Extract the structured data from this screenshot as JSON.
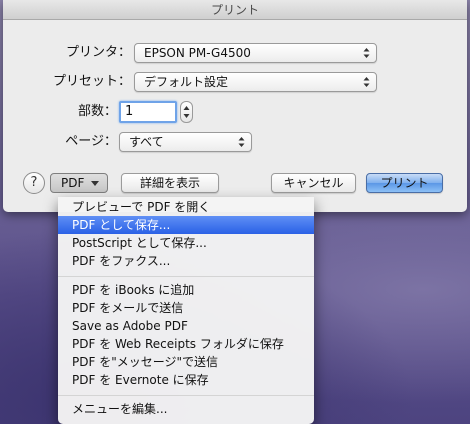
{
  "dialog": {
    "title": "プリント",
    "printer_label": "プリンタ：",
    "printer_value": "EPSON PM-G4500",
    "preset_label": "プリセット：",
    "preset_value": "デフォルト設定",
    "copies_label": "部数：",
    "copies_value": "1",
    "pages_label": "ページ：",
    "pages_value": "すべて",
    "help_label": "?",
    "pdf_label": "PDF",
    "details_label": "詳細を表示",
    "cancel_label": "キャンセル",
    "print_label": "プリント"
  },
  "pdf_menu": {
    "items": [
      "プレビューで PDF を開く",
      "PDF として保存...",
      "PostScript として保存...",
      "PDF をファクス...",
      "PDF を iBooks に追加",
      "PDF をメールで送信",
      "Save as Adobe PDF",
      "PDF を Web Receipts フォルダに保存",
      "PDF を\"メッセージ\"で送信",
      "PDF を Evernote に保存",
      "メニューを編集..."
    ],
    "highlighted_index": 1
  },
  "colors": {
    "accent": "#3a6fe9",
    "dialog_bg": "#ececec"
  }
}
